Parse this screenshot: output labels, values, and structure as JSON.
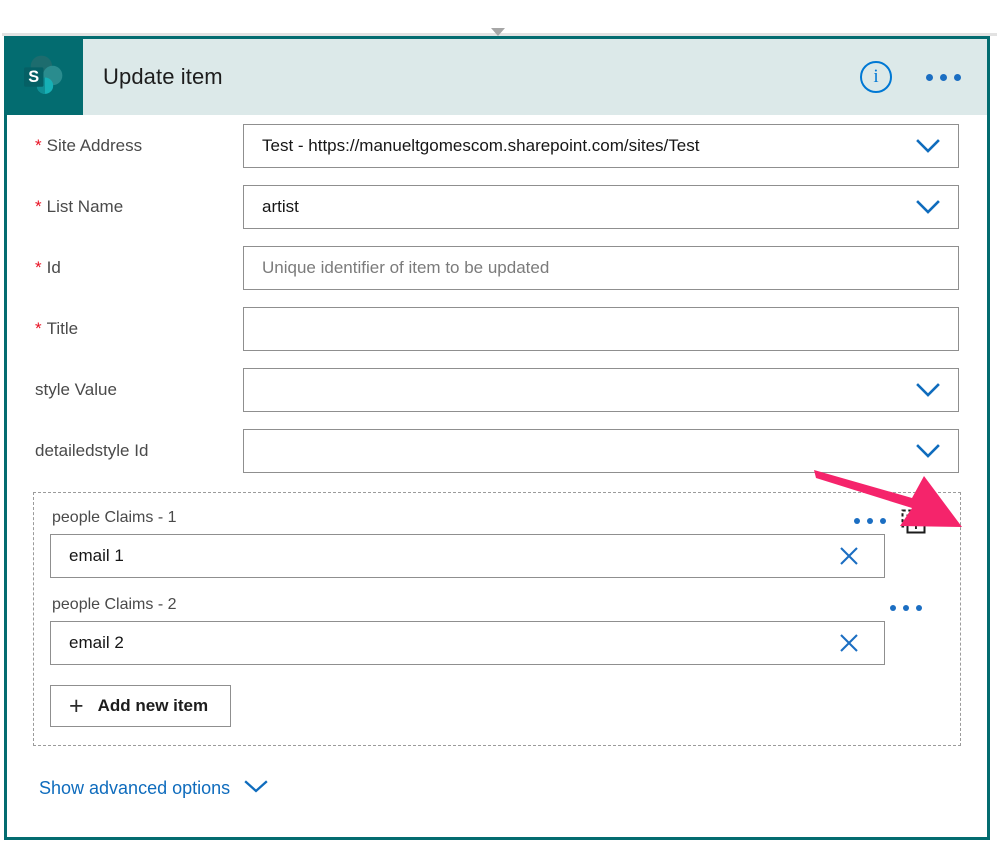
{
  "app": {
    "logo_icon": "sharepoint-logo-icon",
    "title": "Update item",
    "info_icon": "info-icon",
    "info_glyph": "i",
    "more_icon": "ellipsis-icon"
  },
  "colors": {
    "brand_teal": "#036c70",
    "header_bg": "#dce9e9",
    "link_blue": "#0f6cbd",
    "accent_blue": "#1b6ec2",
    "required_red": "#e81123",
    "annotation_pink": "#f5246b"
  },
  "fields": [
    {
      "label": "Site Address",
      "required": true,
      "value": "Test - https://manueltgomescom.sharepoint.com/sites/Test",
      "placeholder": "",
      "is_placeholder": false,
      "has_dropdown": true
    },
    {
      "label": "List Name",
      "required": true,
      "value": "artist",
      "placeholder": "",
      "is_placeholder": false,
      "has_dropdown": true
    },
    {
      "label": "Id",
      "required": true,
      "value": "Unique identifier of item to be updated",
      "placeholder": "Unique identifier of item to be updated",
      "is_placeholder": true,
      "has_dropdown": false
    },
    {
      "label": "Title",
      "required": true,
      "value": "",
      "placeholder": "",
      "is_placeholder": false,
      "has_dropdown": false
    },
    {
      "label": "style Value",
      "required": false,
      "value": "",
      "placeholder": "",
      "is_placeholder": false,
      "has_dropdown": true
    },
    {
      "label": "detailedstyle Id",
      "required": false,
      "value": "",
      "placeholder": "",
      "is_placeholder": false,
      "has_dropdown": true
    }
  ],
  "repeating_section": {
    "items": [
      {
        "label": "people Claims - 1",
        "value": "email 1",
        "clear_icon": "close-x-icon",
        "more_icon": "ellipsis-icon",
        "dynamic_content_icon": "dynamic-content-text-icon"
      },
      {
        "label": "people Claims - 2",
        "value": "email 2",
        "clear_icon": "close-x-icon",
        "more_icon": "ellipsis-icon"
      }
    ],
    "add_button": {
      "plus_glyph": "+",
      "label": "Add new item",
      "icon": "plus-icon"
    }
  },
  "footer": {
    "show_advanced_label": "Show advanced options",
    "chevron_icon": "chevron-down-icon"
  },
  "annotation": {
    "arrow_icon": "pink-arrow-pointer"
  }
}
